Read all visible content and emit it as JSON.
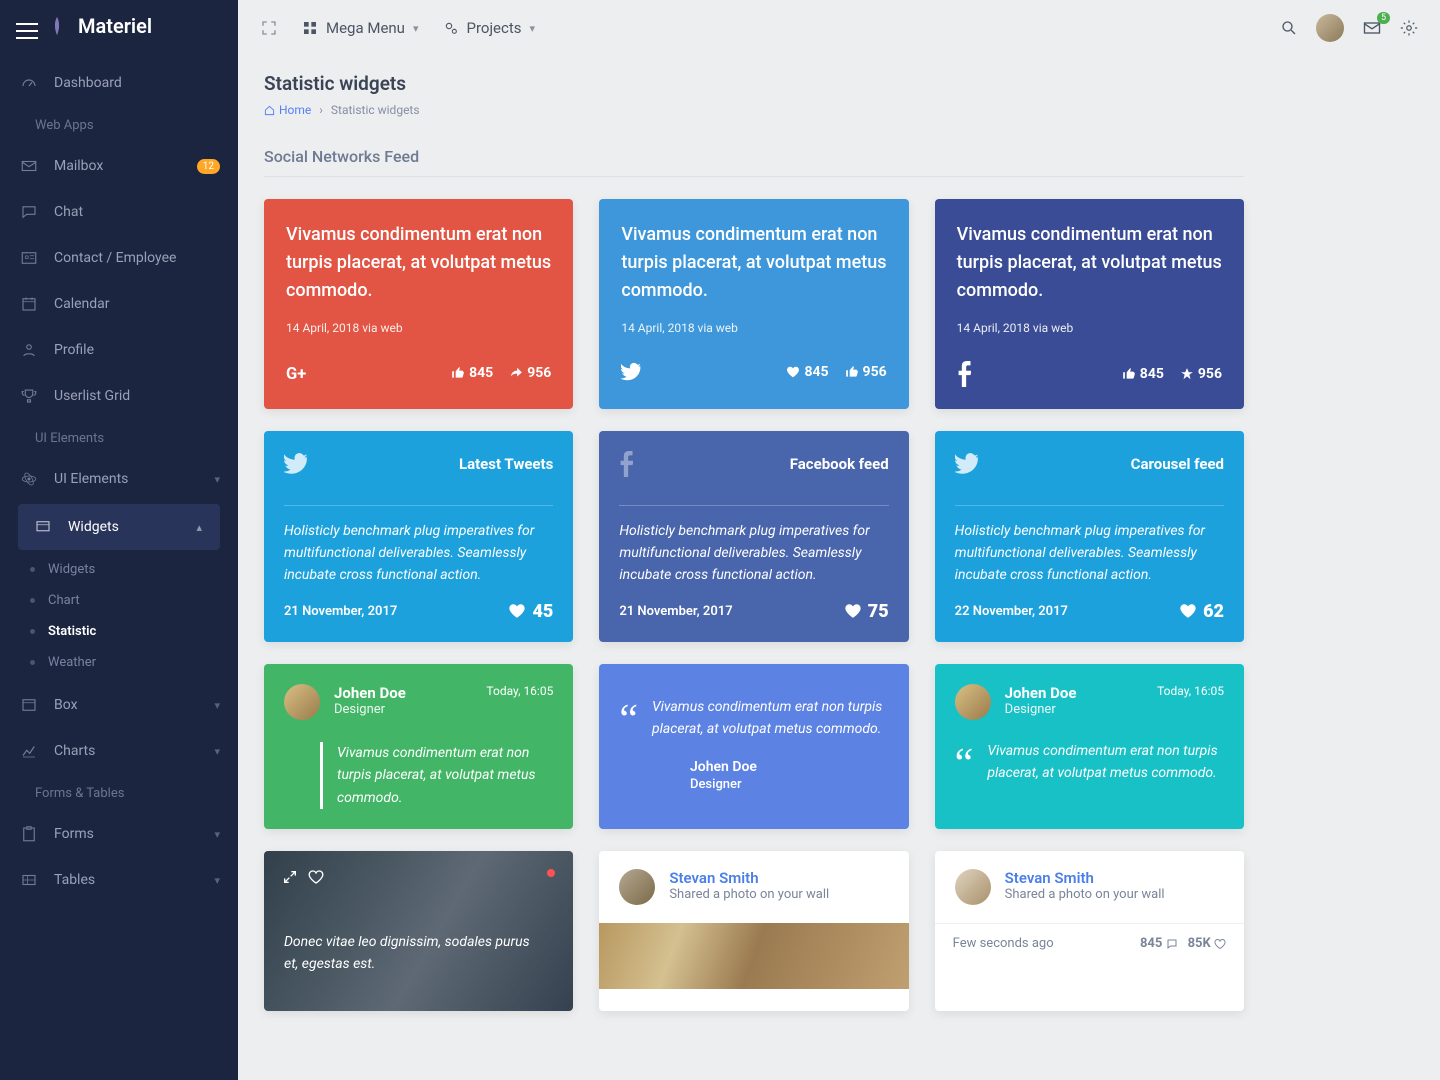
{
  "brand": "Materiel",
  "topbar": {
    "mega_menu": "Mega Menu",
    "projects": "Projects",
    "envelope_count": "5"
  },
  "page": {
    "title": "Statistic widgets",
    "home": "Home",
    "crumb": "Statistic widgets"
  },
  "section_social": "Social Networks Feed",
  "nav": {
    "dashboard": "Dashboard",
    "webapps": "Web Apps",
    "mailbox": "Mailbox",
    "mailbox_badge": "12",
    "chat": "Chat",
    "contact": "Contact / Employee",
    "calendar": "Calendar",
    "profile": "Profile",
    "userlist": "Userlist Grid",
    "ui_elements_h": "UI Elements",
    "ui_elements": "UI Elements",
    "widgets": "Widgets",
    "sub_widgets": "Widgets",
    "sub_chart": "Chart",
    "sub_statistic": "Statistic",
    "sub_weather": "Weather",
    "box": "Box",
    "charts": "Charts",
    "forms_tables_h": "Forms & Tables",
    "forms": "Forms",
    "tables": "Tables"
  },
  "row1": {
    "body": "Vivamus condimentum erat non turpis placerat, at volutpat metus commodo.",
    "date": "14 April, 2018 via web",
    "likes": "845",
    "shares": "956"
  },
  "row2": {
    "twitter_title": "Latest Tweets",
    "facebook_title": "Facebook feed",
    "carousel_title": "Carousel feed",
    "text": "Holisticly benchmark plug imperatives for multifunctional deliverables. Seamlessly incubate cross functional action.",
    "date_a": "21 November, 2017",
    "date_b": "22 November, 2017",
    "cnt1": "45",
    "cnt2": "75",
    "cnt3": "62"
  },
  "row3": {
    "name": "Johen Doe",
    "role": "Designer",
    "time": "Today, 16:05",
    "quote": "Vivamus condimentum erat non turpis placerat, at volutpat metus commodo."
  },
  "row4": {
    "img_text": "Donec vitae leo dignissim, sodales purus et, egestas est.",
    "wall_name": "Stevan Smith",
    "wall_sub": "Shared a photo on your wall",
    "time_ago": "Few seconds ago",
    "n1": "845",
    "n2": "85K"
  }
}
